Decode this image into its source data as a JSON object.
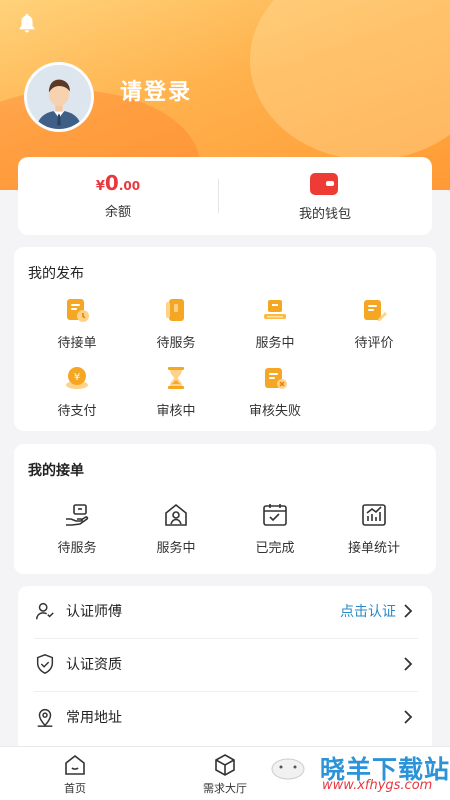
{
  "header": {
    "login_text": "请登录"
  },
  "balance": {
    "currency": "¥",
    "amount_integer": "0",
    "amount_decimal": ".00",
    "label": "余额",
    "wallet_label": "我的钱包"
  },
  "my_publish": {
    "title": "我的发布",
    "items": [
      {
        "label": "待接单",
        "icon": "clipboard-clock-icon"
      },
      {
        "label": "待服务",
        "icon": "phone-icon"
      },
      {
        "label": "服务中",
        "icon": "computer-icon"
      },
      {
        "label": "待评价",
        "icon": "edit-note-icon"
      },
      {
        "label": "待支付",
        "icon": "yuan-coin-icon"
      },
      {
        "label": "审核中",
        "icon": "hourglass-icon"
      },
      {
        "label": "审核失败",
        "icon": "document-error-icon"
      }
    ]
  },
  "my_orders": {
    "title": "我的接单",
    "items": [
      {
        "label": "待服务",
        "icon": "hand-service-icon"
      },
      {
        "label": "服务中",
        "icon": "home-person-icon"
      },
      {
        "label": "已完成",
        "icon": "calendar-check-icon"
      },
      {
        "label": "接单统计",
        "icon": "bar-chart-icon"
      }
    ]
  },
  "menu": [
    {
      "label": "认证师傅",
      "action": "点击认证",
      "icon": "worker-badge-icon"
    },
    {
      "label": "认证资质",
      "action": "",
      "icon": "shield-check-icon"
    },
    {
      "label": "常用地址",
      "action": "",
      "icon": "location-pin-icon"
    }
  ],
  "tabs": [
    {
      "label": "首页",
      "icon": "home-icon"
    },
    {
      "label": "需求大厅",
      "icon": "box-icon"
    }
  ],
  "watermark": {
    "text": "晓羊下载站",
    "url": "www.xfhygs.com"
  },
  "colors": {
    "accent_orange": "#ff9a35",
    "price_red": "#e8383d",
    "link_blue": "#2b8ac6"
  }
}
